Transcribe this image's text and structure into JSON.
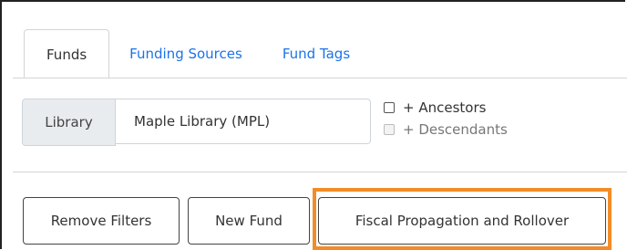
{
  "tabs": [
    {
      "label": "Funds",
      "active": true
    },
    {
      "label": "Funding Sources",
      "active": false
    },
    {
      "label": "Fund Tags",
      "active": false
    }
  ],
  "filter": {
    "label": "Library",
    "selected": "Maple Library (MPL)"
  },
  "checkboxes": [
    {
      "label": "+ Ancestors",
      "checked": false,
      "disabled": false
    },
    {
      "label": "+ Descendants",
      "checked": false,
      "disabled": true
    }
  ],
  "buttons": {
    "remove_filters": "Remove Filters",
    "new_fund": "New Fund",
    "fiscal_propagation": "Fiscal Propagation and Rollover"
  },
  "colors": {
    "link": "#1a73e8",
    "highlight": "#f28c28"
  }
}
